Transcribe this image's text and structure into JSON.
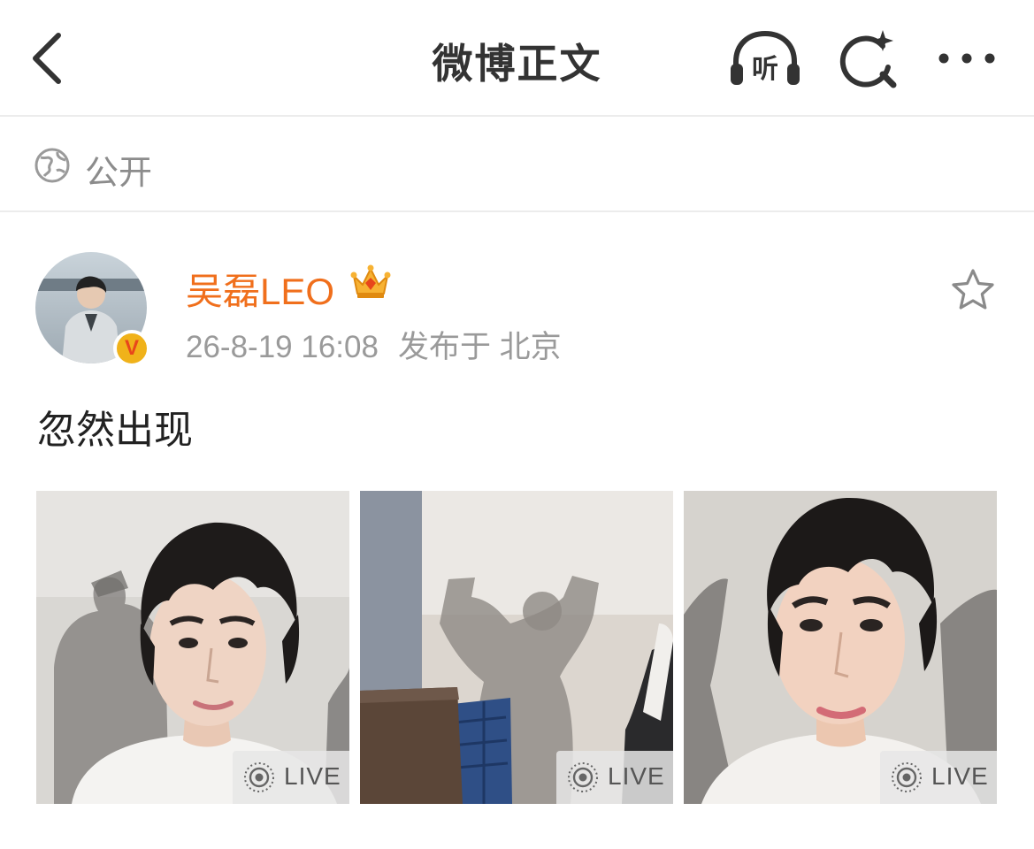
{
  "header": {
    "title": "微博正文",
    "listen_label": "听"
  },
  "visibility": {
    "label": "公开"
  },
  "post": {
    "author": "吴磊LEO",
    "verified_badge": "V",
    "time": "26-8-19 16:08",
    "location": "发布于 北京",
    "text": "忽然出现",
    "images": [
      {
        "badge": "LIVE"
      },
      {
        "badge": "LIVE"
      },
      {
        "badge": "LIVE"
      }
    ]
  },
  "colors": {
    "author_name": "#f06f1c",
    "meta_text": "#9a9a9a",
    "badge_gold": "#f0b21a"
  },
  "icons": [
    "back-icon",
    "listen-icon",
    "search-sparkle-icon",
    "more-icon",
    "globe-icon",
    "crown-icon",
    "star-icon",
    "live-photo-icon"
  ]
}
